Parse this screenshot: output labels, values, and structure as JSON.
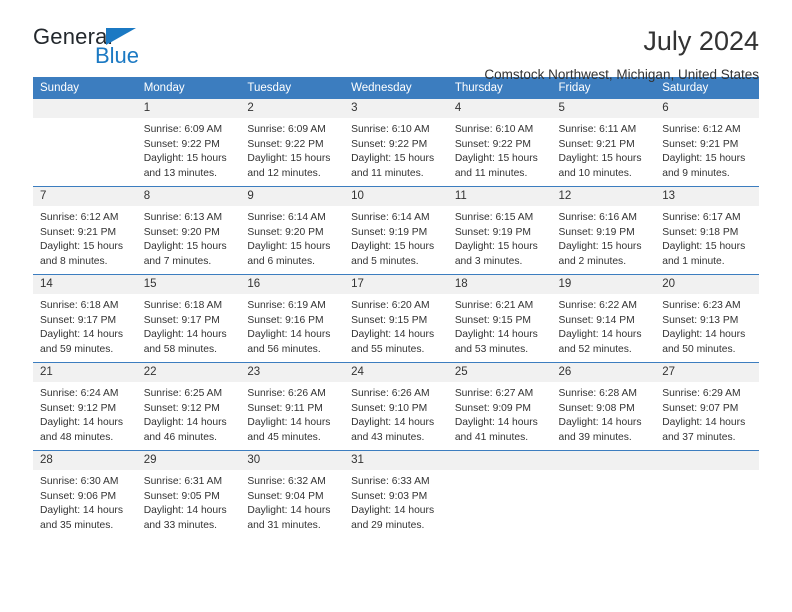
{
  "brand": {
    "name_top": "General",
    "name_bottom": "Blue",
    "accent_color": "#1b79c3"
  },
  "header": {
    "title": "July 2024",
    "subtitle": "Comstock Northwest, Michigan, United States"
  },
  "theme": {
    "header_bg": "#3c7dbf",
    "header_text": "#ffffff",
    "daynum_bg": "#f1f1f1",
    "body_text": "#333333"
  },
  "weekdays": [
    "Sunday",
    "Monday",
    "Tuesday",
    "Wednesday",
    "Thursday",
    "Friday",
    "Saturday"
  ],
  "weeks": [
    [
      {
        "day": "",
        "empty": true
      },
      {
        "day": "1",
        "sunrise": "Sunrise: 6:09 AM",
        "sunset": "Sunset: 9:22 PM",
        "daylight1": "Daylight: 15 hours",
        "daylight2": "and 13 minutes."
      },
      {
        "day": "2",
        "sunrise": "Sunrise: 6:09 AM",
        "sunset": "Sunset: 9:22 PM",
        "daylight1": "Daylight: 15 hours",
        "daylight2": "and 12 minutes."
      },
      {
        "day": "3",
        "sunrise": "Sunrise: 6:10 AM",
        "sunset": "Sunset: 9:22 PM",
        "daylight1": "Daylight: 15 hours",
        "daylight2": "and 11 minutes."
      },
      {
        "day": "4",
        "sunrise": "Sunrise: 6:10 AM",
        "sunset": "Sunset: 9:22 PM",
        "daylight1": "Daylight: 15 hours",
        "daylight2": "and 11 minutes."
      },
      {
        "day": "5",
        "sunrise": "Sunrise: 6:11 AM",
        "sunset": "Sunset: 9:21 PM",
        "daylight1": "Daylight: 15 hours",
        "daylight2": "and 10 minutes."
      },
      {
        "day": "6",
        "sunrise": "Sunrise: 6:12 AM",
        "sunset": "Sunset: 9:21 PM",
        "daylight1": "Daylight: 15 hours",
        "daylight2": "and 9 minutes."
      }
    ],
    [
      {
        "day": "7",
        "sunrise": "Sunrise: 6:12 AM",
        "sunset": "Sunset: 9:21 PM",
        "daylight1": "Daylight: 15 hours",
        "daylight2": "and 8 minutes."
      },
      {
        "day": "8",
        "sunrise": "Sunrise: 6:13 AM",
        "sunset": "Sunset: 9:20 PM",
        "daylight1": "Daylight: 15 hours",
        "daylight2": "and 7 minutes."
      },
      {
        "day": "9",
        "sunrise": "Sunrise: 6:14 AM",
        "sunset": "Sunset: 9:20 PM",
        "daylight1": "Daylight: 15 hours",
        "daylight2": "and 6 minutes."
      },
      {
        "day": "10",
        "sunrise": "Sunrise: 6:14 AM",
        "sunset": "Sunset: 9:19 PM",
        "daylight1": "Daylight: 15 hours",
        "daylight2": "and 5 minutes."
      },
      {
        "day": "11",
        "sunrise": "Sunrise: 6:15 AM",
        "sunset": "Sunset: 9:19 PM",
        "daylight1": "Daylight: 15 hours",
        "daylight2": "and 3 minutes."
      },
      {
        "day": "12",
        "sunrise": "Sunrise: 6:16 AM",
        "sunset": "Sunset: 9:19 PM",
        "daylight1": "Daylight: 15 hours",
        "daylight2": "and 2 minutes."
      },
      {
        "day": "13",
        "sunrise": "Sunrise: 6:17 AM",
        "sunset": "Sunset: 9:18 PM",
        "daylight1": "Daylight: 15 hours",
        "daylight2": "and 1 minute."
      }
    ],
    [
      {
        "day": "14",
        "sunrise": "Sunrise: 6:18 AM",
        "sunset": "Sunset: 9:17 PM",
        "daylight1": "Daylight: 14 hours",
        "daylight2": "and 59 minutes."
      },
      {
        "day": "15",
        "sunrise": "Sunrise: 6:18 AM",
        "sunset": "Sunset: 9:17 PM",
        "daylight1": "Daylight: 14 hours",
        "daylight2": "and 58 minutes."
      },
      {
        "day": "16",
        "sunrise": "Sunrise: 6:19 AM",
        "sunset": "Sunset: 9:16 PM",
        "daylight1": "Daylight: 14 hours",
        "daylight2": "and 56 minutes."
      },
      {
        "day": "17",
        "sunrise": "Sunrise: 6:20 AM",
        "sunset": "Sunset: 9:15 PM",
        "daylight1": "Daylight: 14 hours",
        "daylight2": "and 55 minutes."
      },
      {
        "day": "18",
        "sunrise": "Sunrise: 6:21 AM",
        "sunset": "Sunset: 9:15 PM",
        "daylight1": "Daylight: 14 hours",
        "daylight2": "and 53 minutes."
      },
      {
        "day": "19",
        "sunrise": "Sunrise: 6:22 AM",
        "sunset": "Sunset: 9:14 PM",
        "daylight1": "Daylight: 14 hours",
        "daylight2": "and 52 minutes."
      },
      {
        "day": "20",
        "sunrise": "Sunrise: 6:23 AM",
        "sunset": "Sunset: 9:13 PM",
        "daylight1": "Daylight: 14 hours",
        "daylight2": "and 50 minutes."
      }
    ],
    [
      {
        "day": "21",
        "sunrise": "Sunrise: 6:24 AM",
        "sunset": "Sunset: 9:12 PM",
        "daylight1": "Daylight: 14 hours",
        "daylight2": "and 48 minutes."
      },
      {
        "day": "22",
        "sunrise": "Sunrise: 6:25 AM",
        "sunset": "Sunset: 9:12 PM",
        "daylight1": "Daylight: 14 hours",
        "daylight2": "and 46 minutes."
      },
      {
        "day": "23",
        "sunrise": "Sunrise: 6:26 AM",
        "sunset": "Sunset: 9:11 PM",
        "daylight1": "Daylight: 14 hours",
        "daylight2": "and 45 minutes."
      },
      {
        "day": "24",
        "sunrise": "Sunrise: 6:26 AM",
        "sunset": "Sunset: 9:10 PM",
        "daylight1": "Daylight: 14 hours",
        "daylight2": "and 43 minutes."
      },
      {
        "day": "25",
        "sunrise": "Sunrise: 6:27 AM",
        "sunset": "Sunset: 9:09 PM",
        "daylight1": "Daylight: 14 hours",
        "daylight2": "and 41 minutes."
      },
      {
        "day": "26",
        "sunrise": "Sunrise: 6:28 AM",
        "sunset": "Sunset: 9:08 PM",
        "daylight1": "Daylight: 14 hours",
        "daylight2": "and 39 minutes."
      },
      {
        "day": "27",
        "sunrise": "Sunrise: 6:29 AM",
        "sunset": "Sunset: 9:07 PM",
        "daylight1": "Daylight: 14 hours",
        "daylight2": "and 37 minutes."
      }
    ],
    [
      {
        "day": "28",
        "sunrise": "Sunrise: 6:30 AM",
        "sunset": "Sunset: 9:06 PM",
        "daylight1": "Daylight: 14 hours",
        "daylight2": "and 35 minutes."
      },
      {
        "day": "29",
        "sunrise": "Sunrise: 6:31 AM",
        "sunset": "Sunset: 9:05 PM",
        "daylight1": "Daylight: 14 hours",
        "daylight2": "and 33 minutes."
      },
      {
        "day": "30",
        "sunrise": "Sunrise: 6:32 AM",
        "sunset": "Sunset: 9:04 PM",
        "daylight1": "Daylight: 14 hours",
        "daylight2": "and 31 minutes."
      },
      {
        "day": "31",
        "sunrise": "Sunrise: 6:33 AM",
        "sunset": "Sunset: 9:03 PM",
        "daylight1": "Daylight: 14 hours",
        "daylight2": "and 29 minutes."
      },
      {
        "day": "",
        "empty": true
      },
      {
        "day": "",
        "empty": true
      },
      {
        "day": "",
        "empty": true
      }
    ]
  ]
}
